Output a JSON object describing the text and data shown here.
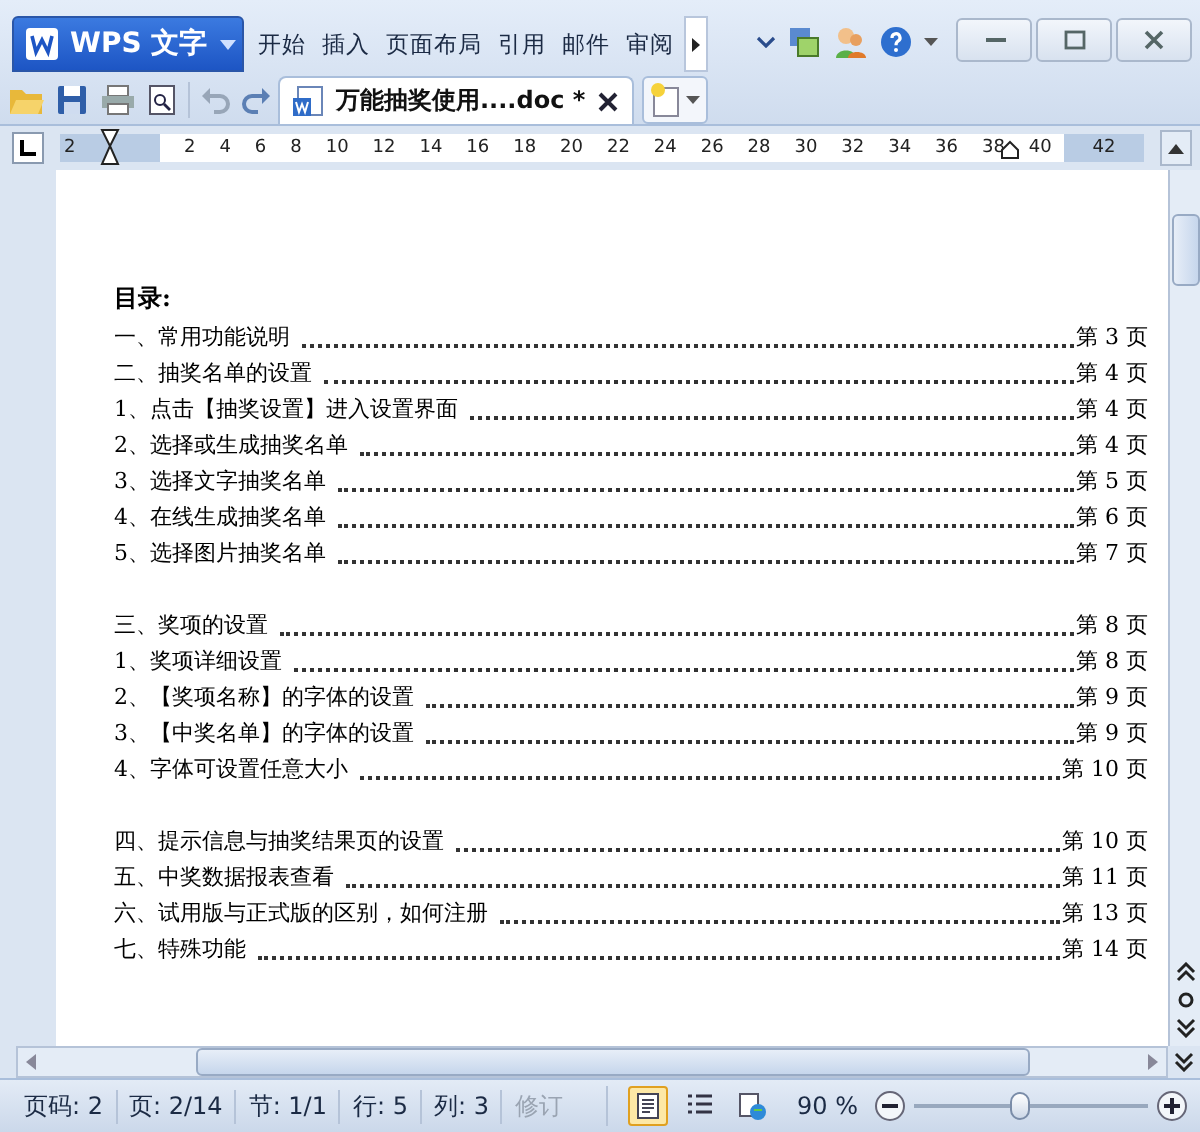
{
  "app_button": {
    "label": "WPS 文字"
  },
  "menu_tabs": [
    {
      "label": "开始",
      "selected": false
    },
    {
      "label": "插入",
      "selected": false
    },
    {
      "label": "页面布局",
      "selected": false
    },
    {
      "label": "引用",
      "selected": false
    },
    {
      "label": "邮件",
      "selected": false
    },
    {
      "label": "审阅",
      "selected": false
    }
  ],
  "document_tab": {
    "title": "万能抽奖使用....doc *",
    "selected": true
  },
  "ruler": {
    "ticks": [
      "2",
      "2",
      "4",
      "6",
      "8",
      "10",
      "12",
      "14",
      "16",
      "18",
      "20",
      "22",
      "24",
      "26",
      "28",
      "30",
      "32",
      "34",
      "36",
      "38",
      "40",
      "42"
    ]
  },
  "toc": {
    "heading": "目录:",
    "groups": [
      [
        {
          "title": "一、常用功能说明",
          "page": "第 3 页"
        },
        {
          "title": "二、抽奖名单的设置",
          "page": "第 4 页"
        },
        {
          "title": "1、点击【抽奖设置】进入设置界面",
          "page": "第 4 页"
        },
        {
          "title": "2、选择或生成抽奖名单",
          "page": "第 4 页"
        },
        {
          "title": "3、选择文字抽奖名单",
          "page": "第 5 页"
        },
        {
          "title": "4、在线生成抽奖名单",
          "page": "第 6 页"
        },
        {
          "title": "5、选择图片抽奖名单",
          "page": "第 7 页"
        }
      ],
      [
        {
          "title": "三、奖项的设置",
          "page": "第 8 页"
        },
        {
          "title": "1、奖项详细设置",
          "page": "第 8 页"
        },
        {
          "title": "2、【奖项名称】的字体的设置",
          "page": "第 9 页"
        },
        {
          "title": "3、【中奖名单】的字体的设置",
          "page": "第 9 页"
        },
        {
          "title": "4、字体可设置任意大小",
          "page": "第 10 页"
        }
      ],
      [
        {
          "title": "四、提示信息与抽奖结果页的设置",
          "page": "第 10 页"
        },
        {
          "title": "五、中奖数据报表查看",
          "page": "第 11 页"
        },
        {
          "title": "六、试用版与正式版的区别，如何注册",
          "page": "第 13 页"
        },
        {
          "title": "七、特殊功能",
          "page": "第 14 页"
        }
      ]
    ]
  },
  "status_bar": {
    "fields": [
      {
        "text": "页码: 2",
        "disabled": false
      },
      {
        "text": "页: 2/14",
        "disabled": false
      },
      {
        "text": "节: 1/1",
        "disabled": false
      },
      {
        "text": "行: 5",
        "disabled": false
      },
      {
        "text": "列: 3",
        "disabled": false
      },
      {
        "text": "修订",
        "disabled": true
      }
    ],
    "views": [
      {
        "selected": true
      },
      {
        "selected": false
      },
      {
        "selected": false
      }
    ],
    "zoom": "90 %",
    "zoom_level": {
      "level": 0.45
    }
  }
}
